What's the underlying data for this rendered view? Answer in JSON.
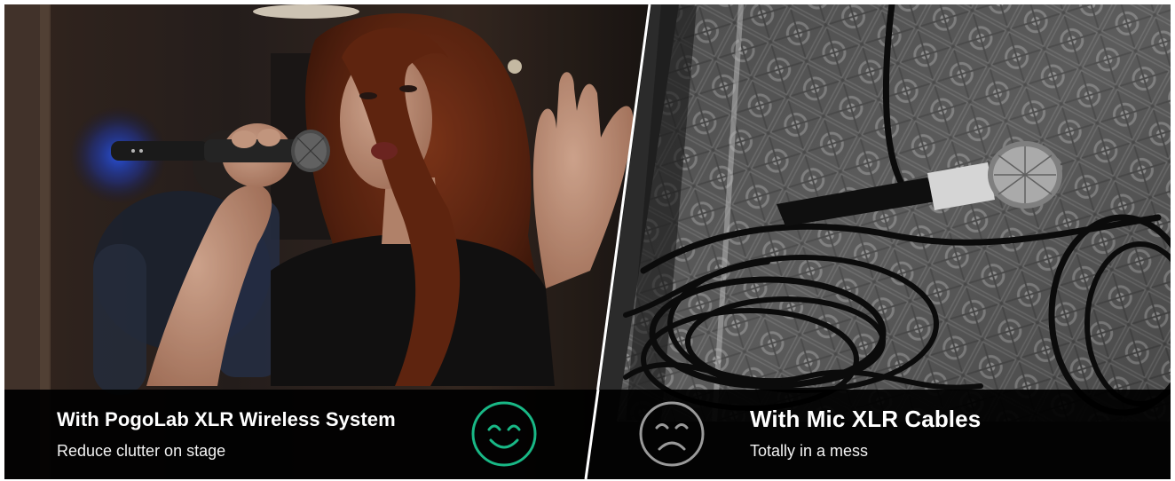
{
  "left_panel": {
    "title": "With PogoLab XLR Wireless System",
    "subtitle": "Reduce clutter on stage",
    "face": "smiley-face-icon",
    "face_color": "#19b886"
  },
  "right_panel": {
    "title": "With Mic XLR Cables",
    "subtitle": "Totally in a mess",
    "face": "sad-face-icon",
    "face_color": "#9a9a9a"
  },
  "colors": {
    "bar_background": "#000000",
    "divider": "#ffffff",
    "wireless_glow": "#2f5fff"
  }
}
